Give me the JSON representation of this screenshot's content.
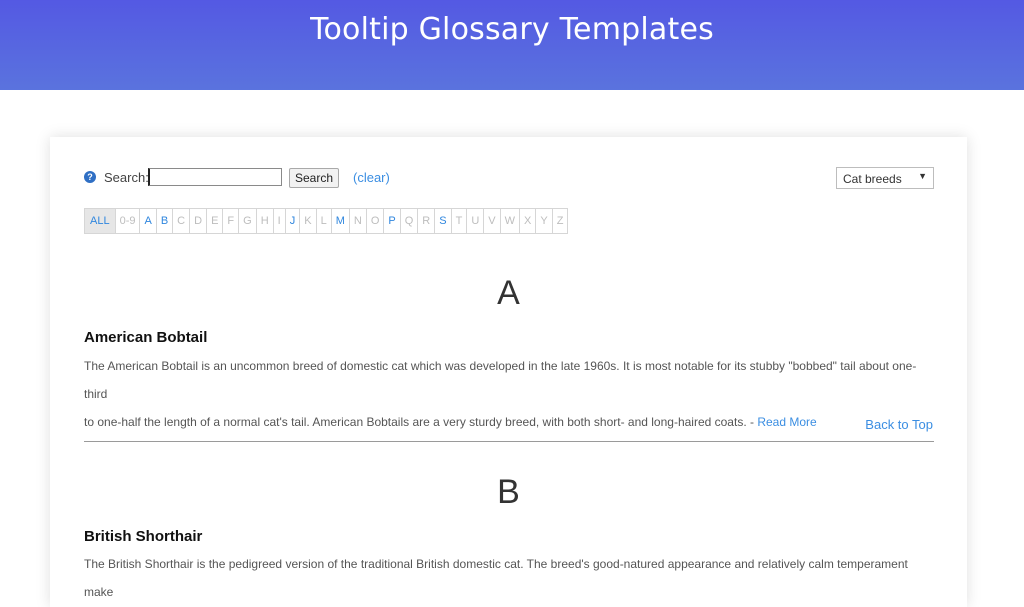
{
  "banner": {
    "title": "Tooltip Glossary Templates",
    "color": "#5459e3"
  },
  "search": {
    "help_icon": "?",
    "label": "Search:",
    "value": "",
    "button_label": "Search",
    "clear_label": "(clear)"
  },
  "category_select": {
    "selected": "Cat breeds",
    "arrow": "▼"
  },
  "letters": [
    {
      "label": "ALL",
      "state": "selected"
    },
    {
      "label": "0-9",
      "state": "disabled"
    },
    {
      "label": "A",
      "state": "active"
    },
    {
      "label": "B",
      "state": "active"
    },
    {
      "label": "C",
      "state": "disabled"
    },
    {
      "label": "D",
      "state": "disabled"
    },
    {
      "label": "E",
      "state": "disabled"
    },
    {
      "label": "F",
      "state": "disabled"
    },
    {
      "label": "G",
      "state": "disabled"
    },
    {
      "label": "H",
      "state": "disabled"
    },
    {
      "label": "I",
      "state": "disabled"
    },
    {
      "label": "J",
      "state": "active"
    },
    {
      "label": "K",
      "state": "disabled"
    },
    {
      "label": "L",
      "state": "disabled"
    },
    {
      "label": "M",
      "state": "active"
    },
    {
      "label": "N",
      "state": "disabled"
    },
    {
      "label": "O",
      "state": "disabled"
    },
    {
      "label": "P",
      "state": "active"
    },
    {
      "label": "Q",
      "state": "disabled"
    },
    {
      "label": "R",
      "state": "disabled"
    },
    {
      "label": "S",
      "state": "active"
    },
    {
      "label": "T",
      "state": "disabled"
    },
    {
      "label": "U",
      "state": "disabled"
    },
    {
      "label": "V",
      "state": "disabled"
    },
    {
      "label": "W",
      "state": "disabled"
    },
    {
      "label": "X",
      "state": "disabled"
    },
    {
      "label": "Y",
      "state": "disabled"
    },
    {
      "label": "Z",
      "state": "disabled"
    }
  ],
  "sections": [
    {
      "letter": "A",
      "term": "American Bobtail",
      "description_line1": "The American Bobtail is an uncommon breed of domestic cat which was developed in the late 1960s. It is most notable for its stubby \"bobbed\" tail about one-third",
      "description_line2": "to one-half the length of a normal cat's tail. American Bobtails are a very sturdy breed, with both short- and long-haired coats. - ",
      "read_more": "Read More",
      "back_to_top": "Back to Top"
    },
    {
      "letter": "B",
      "term": "British Shorthair",
      "description_line1": "The British Shorthair is the pedigreed version of the traditional British domestic cat. The breed's good-natured appearance and relatively calm temperament make"
    }
  ]
}
